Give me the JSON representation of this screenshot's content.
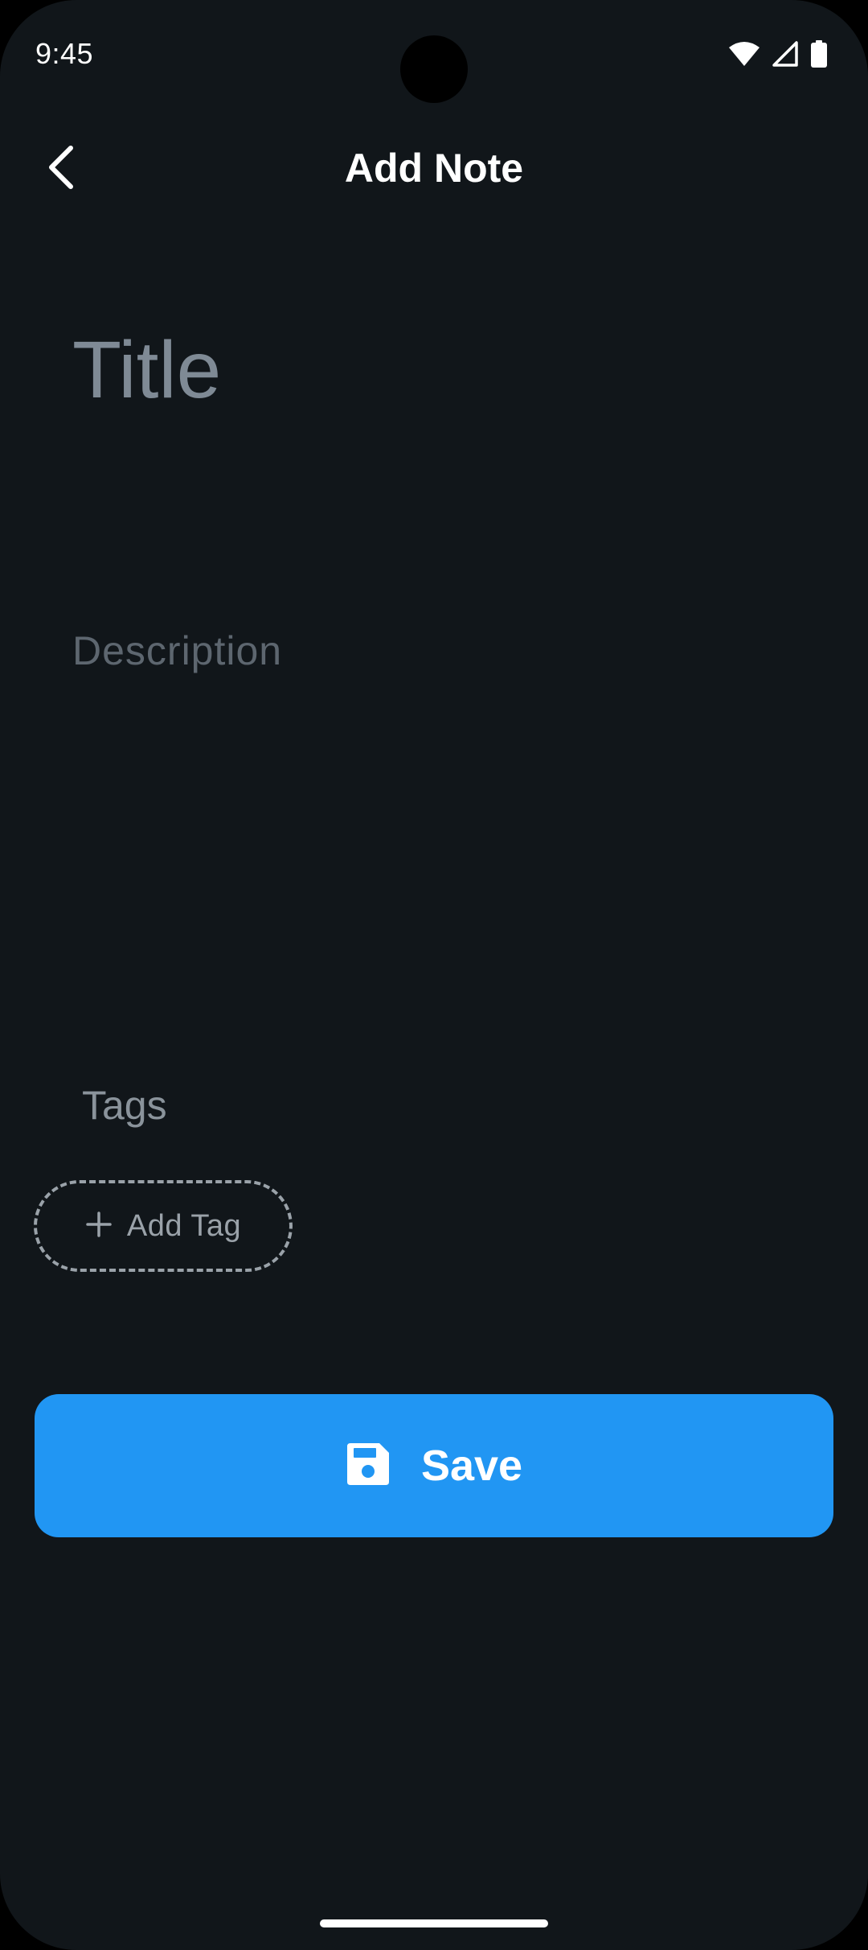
{
  "status_bar": {
    "time": "9:45",
    "icons": [
      "wifi-icon",
      "cellular-signal-icon",
      "battery-icon"
    ]
  },
  "app_bar": {
    "title": "Add Note",
    "back_icon": "chevron-left-icon"
  },
  "form": {
    "title_placeholder": "Title",
    "title_value": "",
    "description_placeholder": "Description",
    "description_value": "",
    "tags_label": "Tags",
    "add_tag_label": "Add Tag",
    "add_tag_icon": "plus-icon"
  },
  "save_button": {
    "label": "Save",
    "icon": "save-icon"
  },
  "colors": {
    "background": "#11161a",
    "accent": "#2196f3",
    "text_primary": "#ffffff",
    "placeholder": "#7f8a95"
  }
}
